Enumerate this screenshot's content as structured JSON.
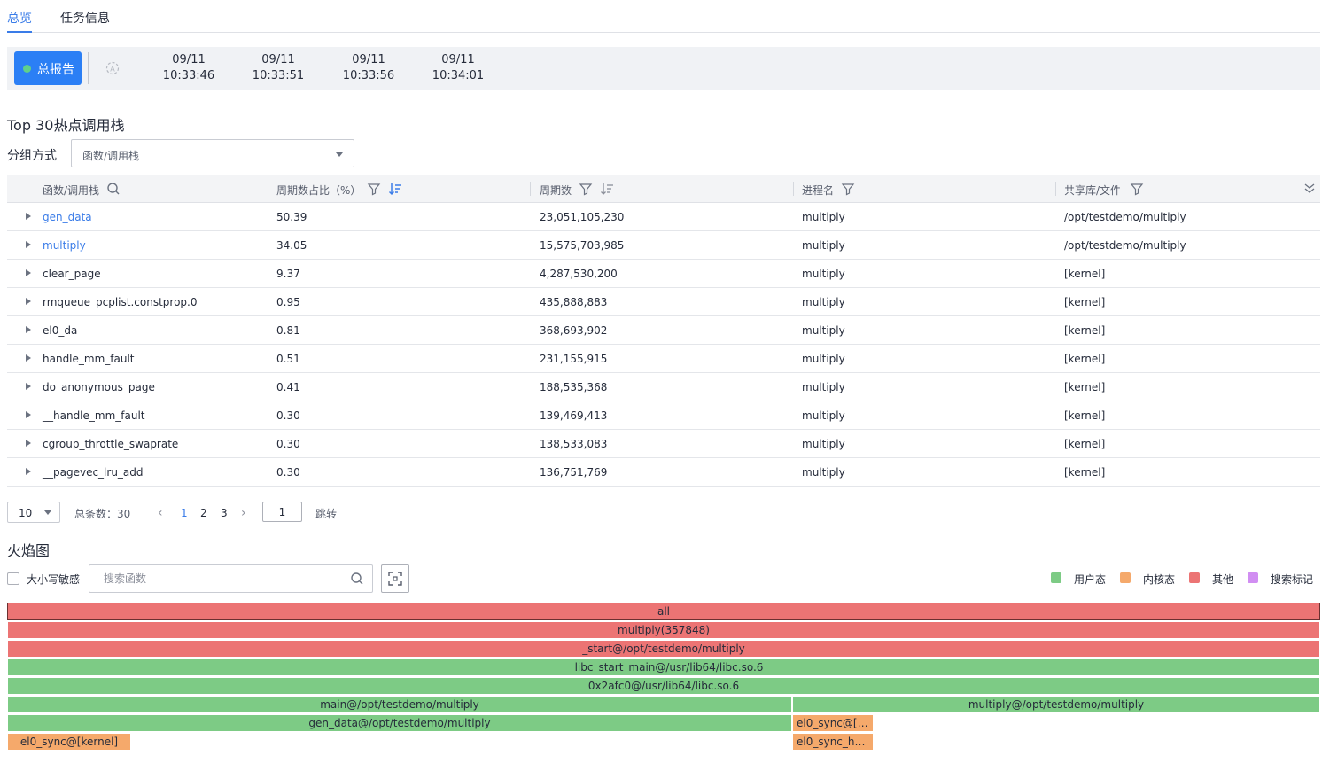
{
  "tabs": [
    {
      "label": "总览",
      "active": true
    },
    {
      "label": "任务信息",
      "active": false
    }
  ],
  "timeline": {
    "report_button": "总报告",
    "ticks": [
      {
        "date": "09/11",
        "time": "10:33:46"
      },
      {
        "date": "09/11",
        "time": "10:33:51"
      },
      {
        "date": "09/11",
        "time": "10:33:56"
      },
      {
        "date": "09/11",
        "time": "10:34:01"
      }
    ]
  },
  "hotspot": {
    "title": "Top 30热点调用栈",
    "group_label": "分组方式",
    "group_value": "函数/调用栈",
    "columns": {
      "func": "函数/调用栈",
      "ratio": "周期数占比（%）",
      "cycles": "周期数",
      "process": "进程名",
      "lib": "共享库/文件"
    },
    "rows": [
      {
        "func": "gen_data",
        "ratio": "50.39",
        "cycles": "23,051,105,230",
        "process": "multiply",
        "lib": "/opt/testdemo/multiply"
      },
      {
        "func": "multiply",
        "ratio": "34.05",
        "cycles": "15,575,703,985",
        "process": "multiply",
        "lib": "/opt/testdemo/multiply"
      },
      {
        "func": "clear_page",
        "ratio": "9.37",
        "cycles": "4,287,530,200",
        "process": "multiply",
        "lib": "[kernel]"
      },
      {
        "func": "rmqueue_pcplist.constprop.0",
        "ratio": "0.95",
        "cycles": "435,888,883",
        "process": "multiply",
        "lib": "[kernel]"
      },
      {
        "func": "el0_da",
        "ratio": "0.81",
        "cycles": "368,693,902",
        "process": "multiply",
        "lib": "[kernel]"
      },
      {
        "func": "handle_mm_fault",
        "ratio": "0.51",
        "cycles": "231,155,915",
        "process": "multiply",
        "lib": "[kernel]"
      },
      {
        "func": "do_anonymous_page",
        "ratio": "0.41",
        "cycles": "188,535,368",
        "process": "multiply",
        "lib": "[kernel]"
      },
      {
        "func": "__handle_mm_fault",
        "ratio": "0.30",
        "cycles": "139,469,413",
        "process": "multiply",
        "lib": "[kernel]"
      },
      {
        "func": "cgroup_throttle_swaprate",
        "ratio": "0.30",
        "cycles": "138,533,083",
        "process": "multiply",
        "lib": "[kernel]"
      },
      {
        "func": "__pagevec_lru_add",
        "ratio": "0.30",
        "cycles": "136,751,769",
        "process": "multiply",
        "lib": "[kernel]"
      }
    ]
  },
  "pagination": {
    "page_size": "10",
    "total": "总条数：30",
    "pages": [
      "1",
      "2",
      "3"
    ],
    "current": "1",
    "jump_label": "跳转"
  },
  "flame": {
    "title": "火焰图",
    "case_sensitive_label": "大小写敏感",
    "search_placeholder": "搜索函数",
    "legend": [
      {
        "label": "用户态",
        "color": "#7dcb85"
      },
      {
        "label": "内核态",
        "color": "#f5a96b"
      },
      {
        "label": "其他",
        "color": "#ec7474"
      },
      {
        "label": "搜索标记",
        "color": "#d18ef2"
      }
    ],
    "frames": {
      "all": "all",
      "multiply_root": "multiply(357848)",
      "start": "_start@/opt/testdemo/multiply",
      "libc_start_main": "__libc_start_main@/usr/lib64/libc.so.6",
      "libc_addr": "0x2afc0@/usr/lib64/libc.so.6",
      "main": "main@/opt/testdemo/multiply",
      "multiply_fn": "multiply@/opt/testdemo/multiply",
      "gen_data": "gen_data@/opt/testdemo/multiply",
      "el0_sync_k": "el0_sync@[k...",
      "el0_sync_kernel": "el0_sync@[kernel]",
      "el0_sync_ha": "el0_sync_ha..."
    }
  }
}
